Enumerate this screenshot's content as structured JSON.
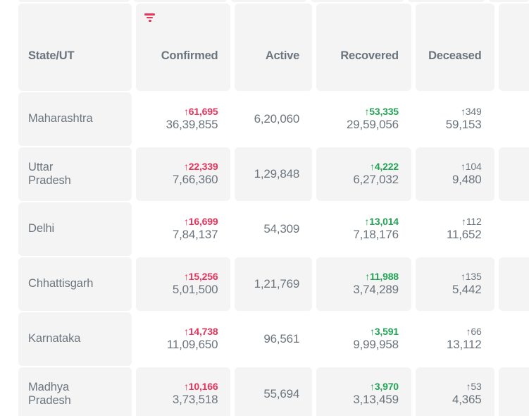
{
  "table": {
    "columns": [
      {
        "key": "state",
        "label": "State/UT",
        "has_filter_icon": false,
        "align": "left"
      },
      {
        "key": "confirmed",
        "label": "Confirmed",
        "has_filter_icon": true,
        "align": "right"
      },
      {
        "key": "active",
        "label": "Active",
        "has_filter_icon": false,
        "align": "right"
      },
      {
        "key": "recovered",
        "label": "Recovered",
        "has_filter_icon": false,
        "align": "right"
      },
      {
        "key": "deceased",
        "label": "Deceased",
        "has_filter_icon": false,
        "align": "right"
      }
    ],
    "icons": {
      "filter": "filter-icon",
      "delta_up": "↑"
    },
    "colors": {
      "confirmed_delta": "#e8335a",
      "recovered_delta": "#22a454",
      "deceased_delta": "#6c757d",
      "text": "#6c757d",
      "cell_background": "#f4f4f5",
      "page_background": "#ffffff"
    },
    "rows": [
      {
        "state": "Maharashtra",
        "state_lines": [
          "Maharashtra"
        ],
        "confirmed": {
          "delta": "↑61,695",
          "total": "36,39,855"
        },
        "active": {
          "delta": "",
          "total": "6,20,060"
        },
        "recovered": {
          "delta": "↑53,335",
          "total": "29,59,056"
        },
        "deceased": {
          "delta": "↑349",
          "total": "59,153"
        }
      },
      {
        "state": "Uttar Pradesh",
        "state_lines": [
          "Uttar",
          "Pradesh"
        ],
        "confirmed": {
          "delta": "↑22,339",
          "total": "7,66,360"
        },
        "active": {
          "delta": "",
          "total": "1,29,848"
        },
        "recovered": {
          "delta": "↑4,222",
          "total": "6,27,032"
        },
        "deceased": {
          "delta": "↑104",
          "total": "9,480"
        }
      },
      {
        "state": "Delhi",
        "state_lines": [
          "Delhi"
        ],
        "confirmed": {
          "delta": "↑16,699",
          "total": "7,84,137"
        },
        "active": {
          "delta": "",
          "total": "54,309"
        },
        "recovered": {
          "delta": "↑13,014",
          "total": "7,18,176"
        },
        "deceased": {
          "delta": "↑112",
          "total": "11,652"
        }
      },
      {
        "state": "Chhattisgarh",
        "state_lines": [
          "Chhattisgarh"
        ],
        "confirmed": {
          "delta": "↑15,256",
          "total": "5,01,500"
        },
        "active": {
          "delta": "",
          "total": "1,21,769"
        },
        "recovered": {
          "delta": "↑11,988",
          "total": "3,74,289"
        },
        "deceased": {
          "delta": "↑135",
          "total": "5,442"
        }
      },
      {
        "state": "Karnataka",
        "state_lines": [
          "Karnataka"
        ],
        "confirmed": {
          "delta": "↑14,738",
          "total": "11,09,650"
        },
        "active": {
          "delta": "",
          "total": "96,561"
        },
        "recovered": {
          "delta": "↑3,591",
          "total": "9,99,958"
        },
        "deceased": {
          "delta": "↑66",
          "total": "13,112"
        }
      },
      {
        "state": "Madhya Pradesh",
        "state_lines": [
          "Madhya",
          "Pradesh"
        ],
        "confirmed": {
          "delta": "↑10,166",
          "total": "3,73,518"
        },
        "active": {
          "delta": "",
          "total": "55,694"
        },
        "recovered": {
          "delta": "↑3,970",
          "total": "3,13,459"
        },
        "deceased": {
          "delta": "↑53",
          "total": "4,365"
        }
      }
    ]
  }
}
